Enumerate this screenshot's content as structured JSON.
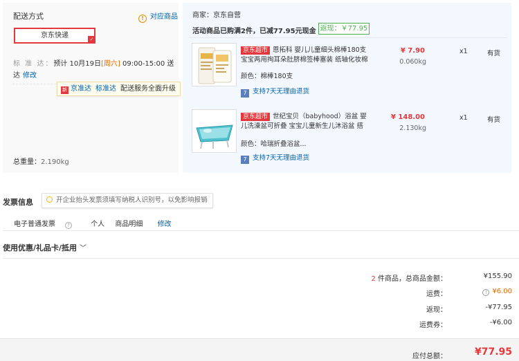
{
  "shipping": {
    "title": "配送方式",
    "sync_link": "对应商品",
    "selected_option": "京东快递",
    "time_label": "标 准 达：",
    "time_prefix": "预计 10月19日",
    "time_day": "[周六]",
    "time_suffix": " 09:00-15:00 送达",
    "modify": "修改",
    "promo_brand1": "京准达",
    "promo_brand2": "标准达",
    "promo_text": "配送服务全面升级",
    "total_weight_label": "总重量：",
    "total_weight_value": "2.190kg"
  },
  "order": {
    "merchant": "商家：京东自营",
    "activity": "活动商品已购满2件，已减77.95元现金",
    "rebate_tag": "返现：￥77.95",
    "items": [
      {
        "store_tag": "京东超市",
        "name": "恩拓科 婴儿儿童细头棉棒180支 宝宝两用掏耳朵肚脐棉签棒塞装 纸轴化妆棉",
        "color": "颜色：棉棒180支",
        "service": "支持7天无理由退货",
        "price": "¥ 7.90",
        "weight": "0.060kg",
        "qty": "x1",
        "stock": "有货"
      },
      {
        "store_tag": "京东超市",
        "name": "世纪宝贝（babyhood）浴盆 婴儿洗澡盆可折叠 宝宝儿童新生儿沐浴盆 搭配",
        "color": "颜色：哈瑞折叠浴盆...",
        "service": "支持7天无理由退货",
        "price": "¥ 148.00",
        "weight": "2.130kg",
        "qty": "x1",
        "stock": "有货"
      }
    ]
  },
  "invoice": {
    "title": "发票信息",
    "tip": "开企业抬头发票须填写纳税人识别号，以免影响报销",
    "type": "电子普通发票",
    "person": "个人",
    "detail": "商品明细",
    "modify": "修改"
  },
  "coupon": {
    "title": "使用优惠/礼品卡/抵用"
  },
  "summary": {
    "count": "2",
    "count_suffix": " 件商品，总商品金额：",
    "total_goods": "¥155.90",
    "shipping_label": "运费：",
    "shipping_value": "¥6.00",
    "rebate_label": "返现：",
    "rebate_value": "-¥77.95",
    "shipping_coupon_label": "运费券：",
    "shipping_coupon_value": "-¥6.00",
    "pay_label": "应付总额：",
    "pay_value": "¥77.95"
  },
  "colors": {
    "accent": "#e4393c",
    "link": "#005ea7",
    "rebate": "#4cb050",
    "goods_bg": "#f3f8fe"
  }
}
